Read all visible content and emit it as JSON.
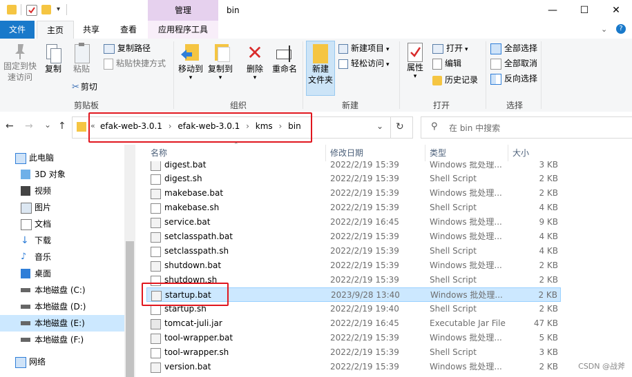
{
  "window": {
    "title": "bin",
    "manage_label": "管理",
    "minimize": "—",
    "maximize": "☐",
    "close": "✕"
  },
  "tabs": {
    "file": "文件",
    "home": "主页",
    "share": "共享",
    "view": "查看",
    "app_tools": "应用程序工具"
  },
  "ribbon": {
    "clipboard": {
      "pin": "固定到快速访问",
      "copy": "复制",
      "paste": "粘贴",
      "copy_path": "复制路径",
      "paste_shortcut": "粘贴快捷方式",
      "cut": "剪切",
      "group": "剪贴板"
    },
    "organize": {
      "move_to": "移动到",
      "copy_to": "复制到",
      "delete": "删除",
      "rename": "重命名",
      "group": "组织"
    },
    "new": {
      "new_folder": "新建\n文件夹",
      "new_item": "新建项目",
      "easy_access": "轻松访问",
      "group": "新建"
    },
    "open": {
      "properties": "属性",
      "open": "打开",
      "edit": "编辑",
      "history": "历史记录",
      "group": "打开"
    },
    "select": {
      "select_all": "全部选择",
      "select_none": "全部取消",
      "invert": "反向选择",
      "group": "选择"
    }
  },
  "address": {
    "back": "←",
    "forward": "→",
    "recent": "⌄",
    "up": "↑",
    "overflow": "«",
    "crumbs": [
      "efak-web-3.0.1",
      "efak-web-3.0.1",
      "kms",
      "bin"
    ],
    "search_placeholder": "在 bin 中搜索"
  },
  "nav": {
    "items": [
      {
        "label": "此电脑",
        "icon": "computer-icon"
      },
      {
        "label": "3D 对象",
        "icon": "cube-icon"
      },
      {
        "label": "视频",
        "icon": "video-icon"
      },
      {
        "label": "图片",
        "icon": "picture-icon"
      },
      {
        "label": "文档",
        "icon": "document-icon"
      },
      {
        "label": "下载",
        "icon": "download-icon"
      },
      {
        "label": "音乐",
        "icon": "music-icon"
      },
      {
        "label": "桌面",
        "icon": "desktop-icon"
      },
      {
        "label": "本地磁盘 (C:)",
        "icon": "drive-icon"
      },
      {
        "label": "本地磁盘 (D:)",
        "icon": "drive-icon"
      },
      {
        "label": "本地磁盘 (E:)",
        "icon": "drive-icon"
      },
      {
        "label": "本地磁盘 (F:)",
        "icon": "drive-icon"
      },
      {
        "label": "网络",
        "icon": "network-icon"
      }
    ]
  },
  "columns": {
    "name": "名称",
    "date": "修改日期",
    "type": "类型",
    "size": "大小"
  },
  "files": [
    {
      "name": "digest.bat",
      "date": "2022/2/19 15:39",
      "type": "Windows 批处理...",
      "size": "3 KB"
    },
    {
      "name": "digest.sh",
      "date": "2022/2/19 15:39",
      "type": "Shell Script",
      "size": "2 KB"
    },
    {
      "name": "makebase.bat",
      "date": "2022/2/19 15:39",
      "type": "Windows 批处理...",
      "size": "2 KB"
    },
    {
      "name": "makebase.sh",
      "date": "2022/2/19 15:39",
      "type": "Shell Script",
      "size": "4 KB"
    },
    {
      "name": "service.bat",
      "date": "2022/2/19 16:45",
      "type": "Windows 批处理...",
      "size": "9 KB"
    },
    {
      "name": "setclasspath.bat",
      "date": "2022/2/19 15:39",
      "type": "Windows 批处理...",
      "size": "4 KB"
    },
    {
      "name": "setclasspath.sh",
      "date": "2022/2/19 15:39",
      "type": "Shell Script",
      "size": "4 KB"
    },
    {
      "name": "shutdown.bat",
      "date": "2022/2/19 15:39",
      "type": "Windows 批处理...",
      "size": "2 KB"
    },
    {
      "name": "shutdown.sh",
      "date": "2022/2/19 15:39",
      "type": "Shell Script",
      "size": "2 KB"
    },
    {
      "name": "startup.bat",
      "date": "2023/9/28 13:40",
      "type": "Windows 批处理...",
      "size": "2 KB"
    },
    {
      "name": "startup.sh",
      "date": "2022/2/19 19:40",
      "type": "Shell Script",
      "size": "2 KB"
    },
    {
      "name": "tomcat-juli.jar",
      "date": "2022/2/19 16:45",
      "type": "Executable Jar File",
      "size": "47 KB"
    },
    {
      "name": "tool-wrapper.bat",
      "date": "2022/2/19 15:39",
      "type": "Windows 批处理...",
      "size": "5 KB"
    },
    {
      "name": "tool-wrapper.sh",
      "date": "2022/2/19 15:39",
      "type": "Shell Script",
      "size": "3 KB"
    },
    {
      "name": "version.bat",
      "date": "2022/2/19 15:39",
      "type": "Windows 批处理...",
      "size": "2 KB"
    }
  ],
  "watermark": "CSDN @战斧",
  "colors": {
    "accent": "#1979ca",
    "selection": "#cce8ff",
    "highlight": "#e0161e",
    "manage_tab": "#e6d1ee"
  }
}
